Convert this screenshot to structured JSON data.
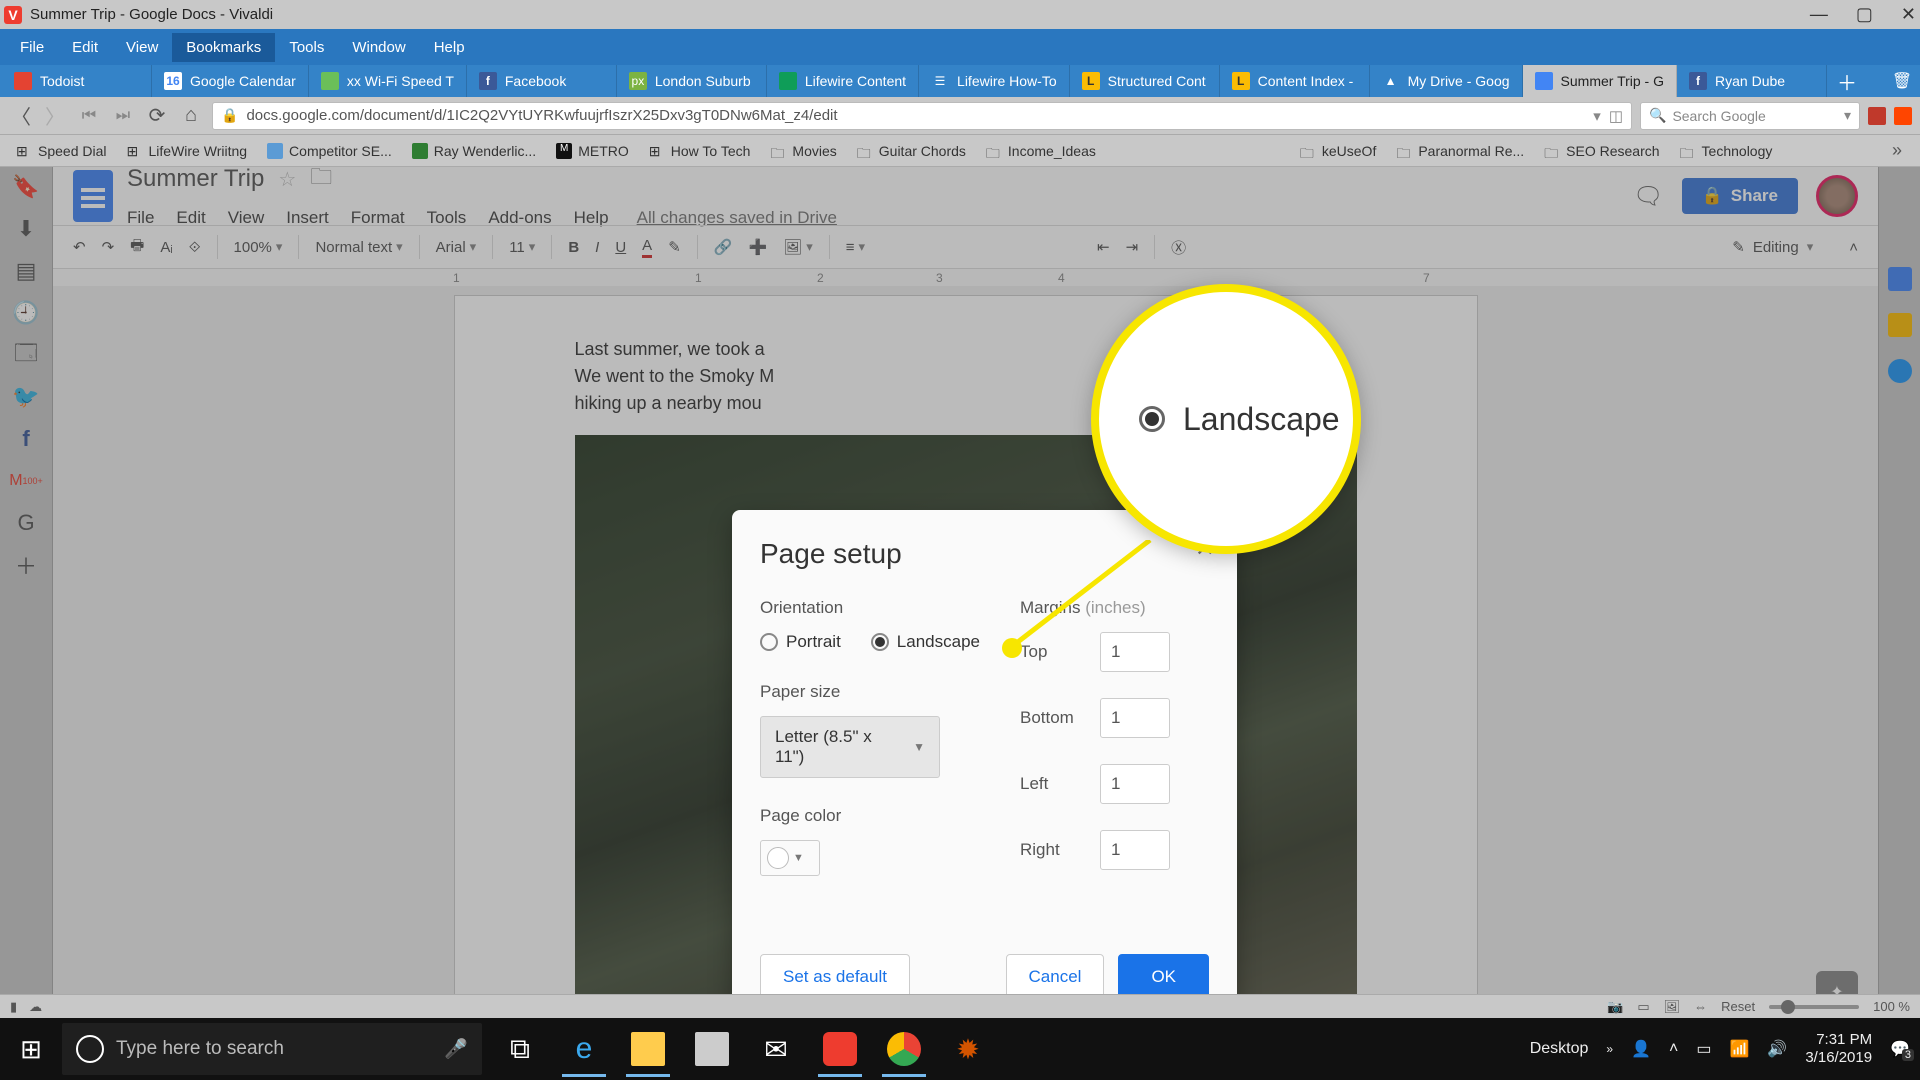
{
  "window": {
    "title": "Summer Trip - Google Docs - Vivaldi"
  },
  "menus": {
    "file": "File",
    "edit": "Edit",
    "view": "View",
    "bookmarks": "Bookmarks",
    "tools": "Tools",
    "window": "Window",
    "help": "Help"
  },
  "tabs": [
    {
      "label": "Todoist"
    },
    {
      "label": "Google Calendar"
    },
    {
      "label": "xx Wi-Fi Speed T"
    },
    {
      "label": "Facebook"
    },
    {
      "label": "London Suburb"
    },
    {
      "label": "Lifewire Content"
    },
    {
      "label": "Lifewire How-To"
    },
    {
      "label": "Structured Cont"
    },
    {
      "label": "Content Index -"
    },
    {
      "label": "My Drive - Goog"
    },
    {
      "label": "Summer Trip - G"
    },
    {
      "label": "Ryan Dube"
    }
  ],
  "active_tab_index": 10,
  "address": {
    "url": "docs.google.com/document/d/1IC2Q2VYtUYRKwfuujrfIszrX25Dxv3gT0DNw6Mat_z4/edit"
  },
  "search": {
    "placeholder": "Search Google"
  },
  "bookmarks": [
    "Speed Dial",
    "LifeWire Wriitng",
    "Competitor SE...",
    "Ray Wenderlic...",
    "METRO",
    "How To Tech",
    "Movies",
    "Guitar Chords",
    "Income_Ideas",
    "",
    "keUseOf",
    "Paranormal Re...",
    "SEO Research",
    "Technology"
  ],
  "gdocs": {
    "doc_title": "Summer Trip",
    "menus": {
      "file": "File",
      "edit": "Edit",
      "view": "View",
      "insert": "Insert",
      "format": "Format",
      "tools": "Tools",
      "addons": "Add-ons",
      "help": "Help"
    },
    "saved": "All changes saved in Drive",
    "share": "Share",
    "toolbar": {
      "zoom": "100%",
      "style": "Normal text",
      "font": "Arial",
      "size": "11",
      "mode": "Editing"
    },
    "ruler": [
      "1",
      "1",
      "2",
      "3",
      "4",
      "",
      "",
      "7"
    ],
    "body": {
      "p1": "Last summer, we took a",
      "p2a": "We went to the Smoky M",
      "p2b": "e went",
      "p3": "hiking up a nearby mou"
    }
  },
  "dialog": {
    "title": "Page setup",
    "orientation_label": "Orientation",
    "portrait": "Portrait",
    "landscape": "Landscape",
    "paper_label": "Paper size",
    "paper_value": "Letter (8.5\" x 11\")",
    "color_label": "Page color",
    "margins_label": "Margins",
    "margins_unit": "(inches)",
    "margins": {
      "top_label": "Top",
      "top": "1",
      "bottom_label": "Bottom",
      "bottom": "1",
      "left_label": "Left",
      "left": "1",
      "right_label": "Right",
      "right": "1"
    },
    "buttons": {
      "default": "Set as default",
      "cancel": "Cancel",
      "ok": "OK"
    }
  },
  "callout": {
    "label": "Landscape"
  },
  "vstatus": {
    "reset": "Reset",
    "zoom": "100 %"
  },
  "taskbar": {
    "search_placeholder": "Type here to search",
    "desktop": "Desktop",
    "time": "7:31 PM",
    "date": "3/16/2019",
    "notif_count": "3"
  }
}
